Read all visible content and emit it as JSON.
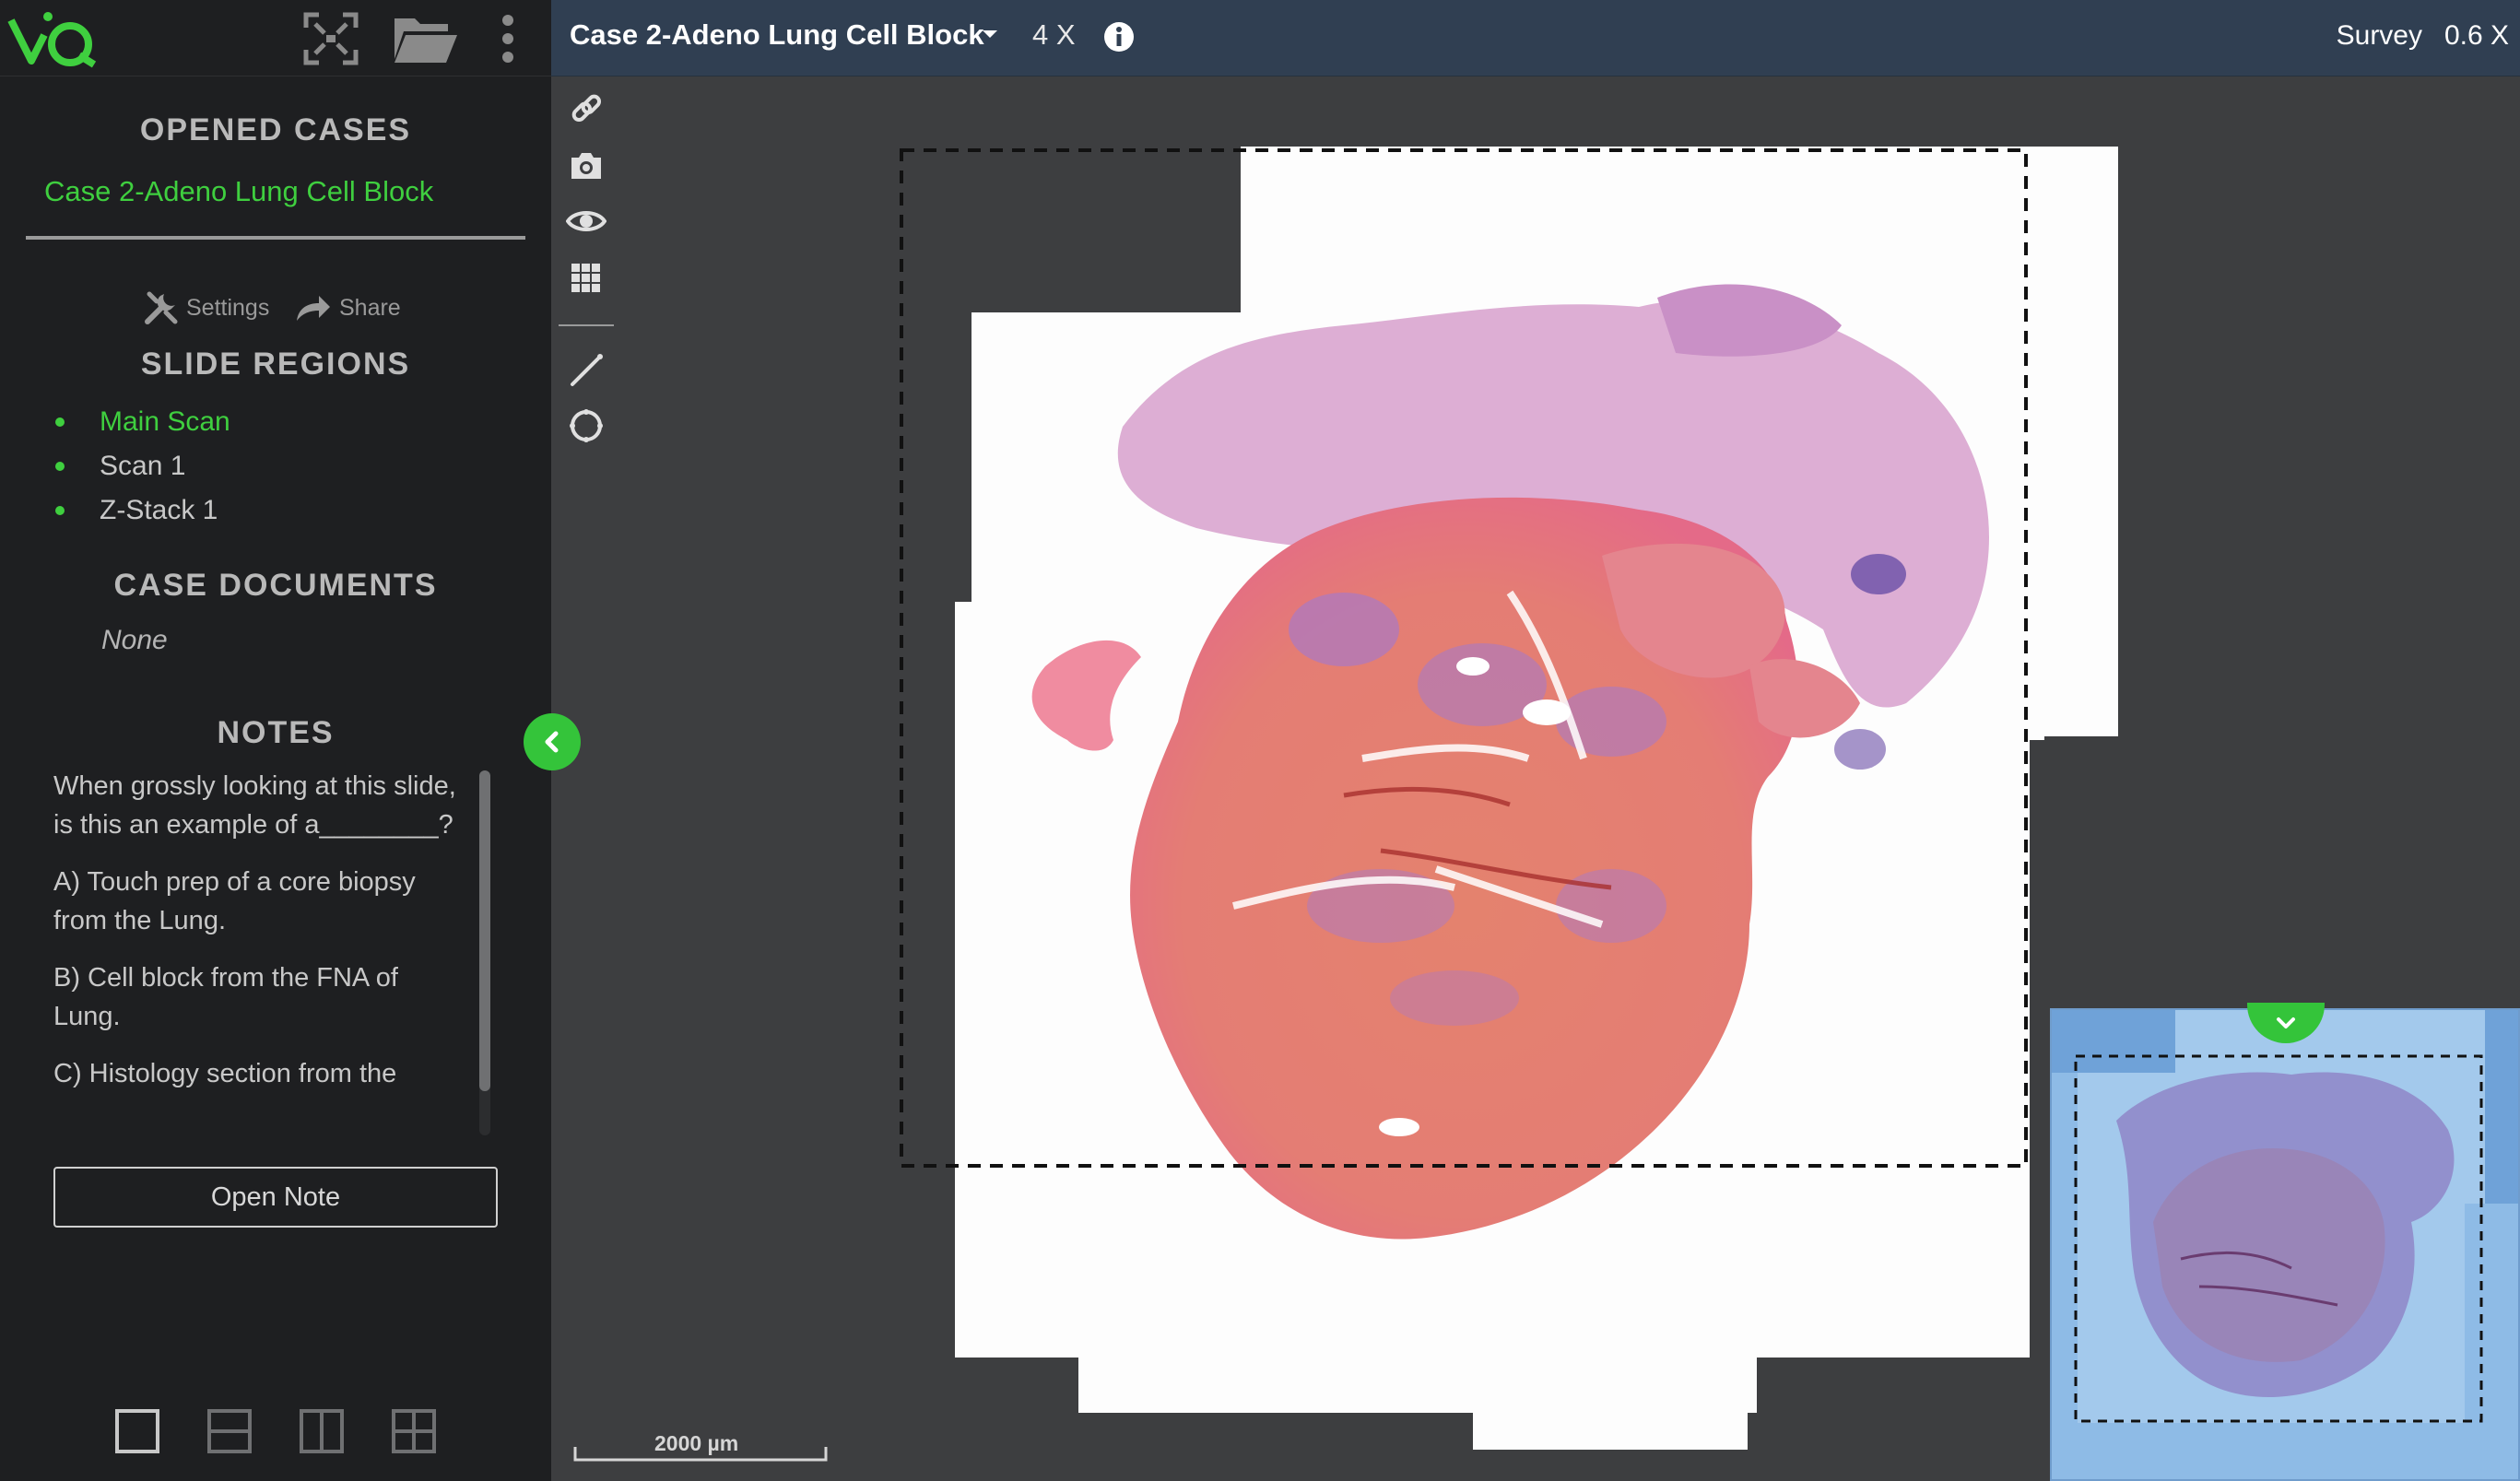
{
  "app": {
    "logo": "iQ"
  },
  "sidebar": {
    "opened_cases_title": "OPENED CASES",
    "opened_case": "Case 2-Adeno Lung Cell Block",
    "settings_label": "Settings",
    "share_label": "Share",
    "slide_regions_title": "SLIDE REGIONS",
    "regions": [
      {
        "label": "Main Scan"
      },
      {
        "label": "Scan 1"
      },
      {
        "label": "Z-Stack 1"
      }
    ],
    "case_documents_title": "CASE DOCUMENTS",
    "case_documents_empty": "None",
    "notes_title": "NOTES",
    "notes": [
      "When grossly looking at this slide, is this an example of a________?",
      "A) Touch prep of a core biopsy from the Lung.",
      "B) Cell block from the FNA of Lung.",
      "C) Histology section from the"
    ],
    "open_note_label": "Open Note"
  },
  "header": {
    "case_title": "Case 2-Adeno Lung Cell Block",
    "zoom": "4 X",
    "mode_label": "Survey",
    "mode_value": "0.6 X"
  },
  "viewer": {
    "scale_label": "2000  µm"
  },
  "colors": {
    "accent_green": "#3fcf3f",
    "header_bg": "#303f52",
    "sidebar_bg": "#1e1f21",
    "viewer_bg": "#3d3e40",
    "minimap_bg": "#8ebbe6"
  }
}
